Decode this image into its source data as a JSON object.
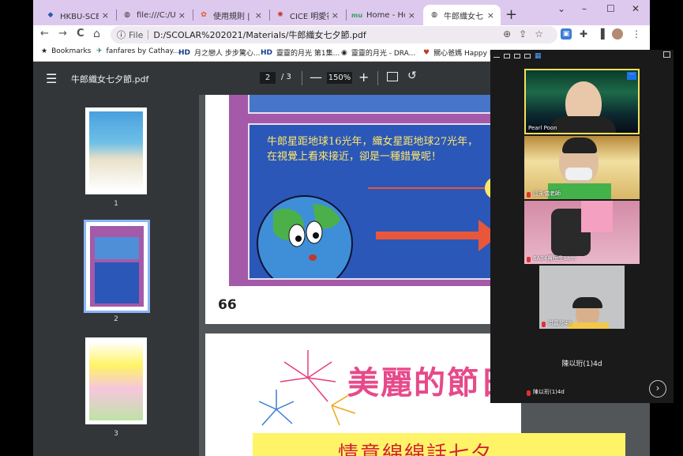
{
  "tabs": [
    {
      "label": "HKBU-SCE - 年",
      "favicon": "hkbu-icon",
      "close": "×"
    },
    {
      "label": "file:///C:/User",
      "favicon": "globe-icon",
      "close": "×"
    },
    {
      "label": "使用規則 | Co",
      "favicon": "rules-icon",
      "close": "×"
    },
    {
      "label": "CICE 明愛社區",
      "favicon": "cice-icon",
      "close": "×"
    },
    {
      "label": "Home - Hong",
      "favicon": "mu-icon",
      "close": "×"
    },
    {
      "label": "牛郎織女七夕",
      "favicon": "globe-icon",
      "close": "×"
    }
  ],
  "new_tab": "+",
  "window_controls": {
    "chevron": "⌄",
    "minimize": "–",
    "maximize": "☐",
    "close": "✕"
  },
  "toolbar": {
    "back": "←",
    "forward": "→",
    "reload": "C",
    "home": "⌂",
    "info": "ⓘ",
    "file_label": "File",
    "url": "D:/SCOLAR%202021/Materials/牛郎織女七夕節.pdf",
    "icons": [
      "zoom-icon",
      "share-icon",
      "star-icon"
    ]
  },
  "bookmarks": [
    {
      "label": "Bookmarks",
      "icon": "★"
    },
    {
      "label": "fanfares by Cathay...",
      "icon": "✈"
    },
    {
      "label": "月之戀人 步步驚心...",
      "icon": "HD"
    },
    {
      "label": "靈靈的月光 第1集...",
      "icon": "HD"
    },
    {
      "label": "靈靈的月光 - DRA...",
      "icon": "◉"
    },
    {
      "label": "關心爸媽 Happy P...",
      "icon": "♥"
    }
  ],
  "pdf": {
    "menu": "☰",
    "title": "牛郎織女七夕節.pdf",
    "page": "2",
    "page_total": "/ 3",
    "zoom_out": "—",
    "zoom": "150%",
    "zoom_in": "+",
    "rotate": "↺"
  },
  "thumbnails": [
    {
      "label": "1"
    },
    {
      "label": "2"
    },
    {
      "label": "3"
    }
  ],
  "page_content": {
    "story": "牛郎星距地球16光年，織女星距地球27光年，在視覺上看來接近，卻是一種錯覺呢！",
    "page_number": "66",
    "festival_title": "美麗的節日",
    "banner": "情意綿綿話七夕"
  },
  "meeting": {
    "participants": [
      {
        "name": "Pearl Poon"
      },
      {
        "name": "區永儀老師"
      },
      {
        "name": "6A04賈恒生sam"
      },
      {
        "name": "洪嘉欣48"
      },
      {
        "name": "陳以珩(1)4d",
        "center_name": "陳以珩(1)4d"
      }
    ],
    "next": "›"
  }
}
